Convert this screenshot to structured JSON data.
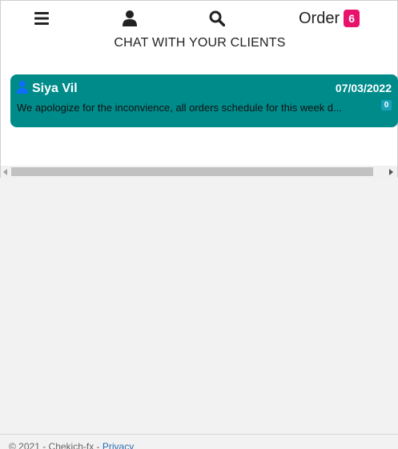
{
  "nav": {
    "menu_icon": "bars-icon",
    "user_icon": "user-icon",
    "search_icon": "search-icon",
    "order_label": "Order",
    "order_count": "6"
  },
  "page": {
    "title": "CHAT WITH YOUR CLIENTS"
  },
  "chats": [
    {
      "name": "Siya Vil",
      "date": "07/03/2022",
      "message": "We apologize for the inconvience, all orders schedule for this week d...",
      "unread": "0",
      "icon": "user-icon"
    }
  ],
  "footer": {
    "copyright": "© 2021 - Chekich-fx - ",
    "privacy_link": "Privacy"
  },
  "colors": {
    "chat_card_bg": "#008b8b",
    "order_badge": "#e8126b",
    "unread_badge": "#17a2b8",
    "user_icon_blue": "#0d6efd"
  }
}
